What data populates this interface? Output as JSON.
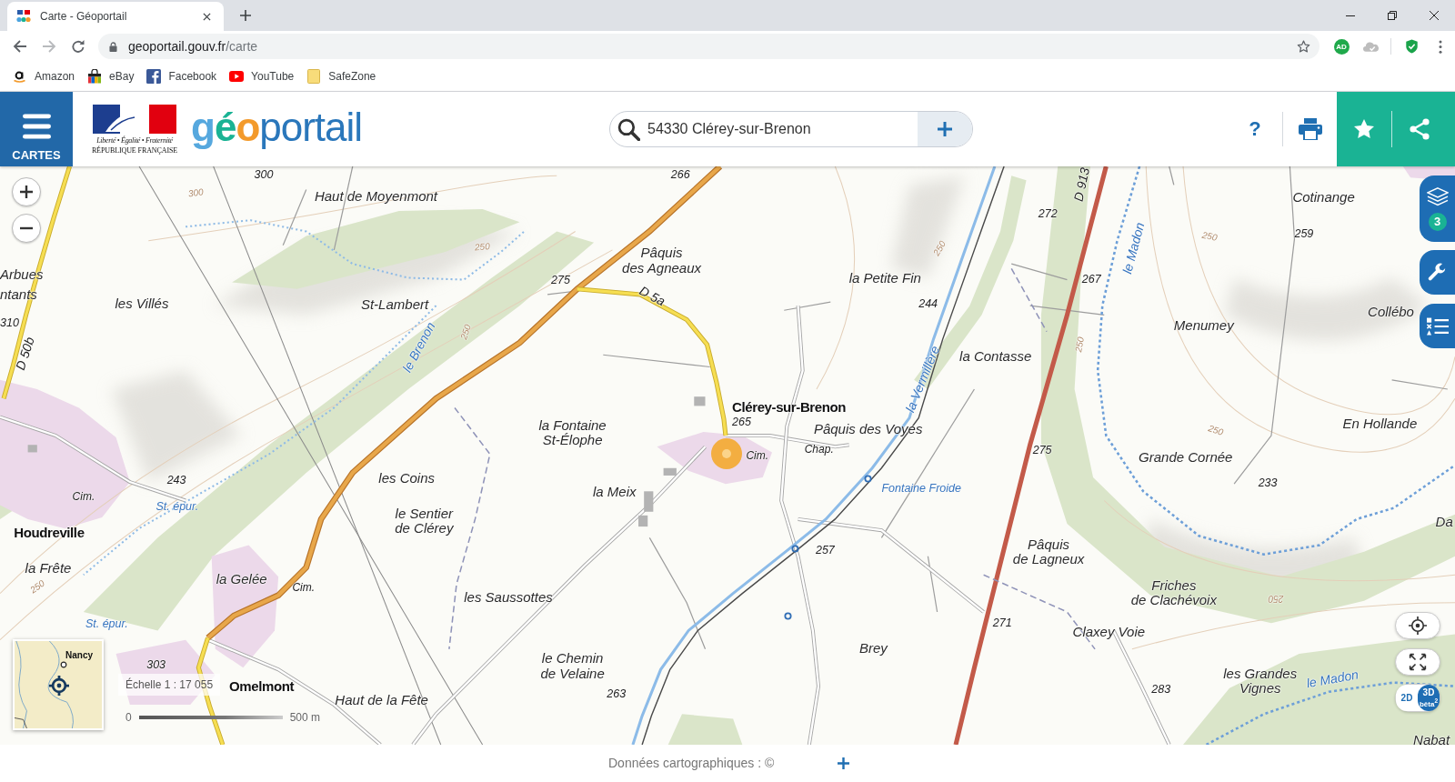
{
  "browser": {
    "tabs": [
      {
        "title": "Carte - Géoportail",
        "selected": true
      }
    ],
    "nav": [
      {
        "kind": "back",
        "disabled": false
      },
      {
        "kind": "forward",
        "disabled": true
      },
      {
        "kind": "reload",
        "disabled": false
      }
    ],
    "address": {
      "domain": "geoportail.gouv.fr",
      "path": "/carte"
    },
    "extensions": [
      {
        "kind": "badge",
        "label": "AD"
      },
      {
        "kind": "cloud"
      },
      {
        "kind": "shield"
      }
    ],
    "bookmarks": [
      {
        "label": "Amazon",
        "kind": "amazon"
      },
      {
        "label": "eBay",
        "kind": "bag"
      },
      {
        "label": "Facebook",
        "kind": "facebook"
      },
      {
        "label": "YouTube",
        "kind": "video"
      },
      {
        "label": "SafeZone",
        "kind": "folder"
      }
    ]
  },
  "header": {
    "menu_label": "CARTES",
    "republic_logo": {
      "motto": "Liberté • Égalité • Fraternité",
      "name": "RÉPUBLIQUE FRANÇAISE"
    },
    "site_logo": [
      {
        "text": "g",
        "kind": "light"
      },
      {
        "text": "é",
        "kind": "green"
      },
      {
        "text": "o",
        "kind": "accent"
      },
      {
        "text": "portail",
        "kind": "dark"
      }
    ],
    "search": {
      "value": "54330 Clérey-sur-Brenon"
    },
    "help": "?"
  },
  "map": {
    "labels": [
      {
        "text": "300",
        "kind": "elevation"
      },
      {
        "text": "266",
        "kind": "elevation"
      },
      {
        "text": "300",
        "kind": "contour"
      },
      {
        "text": "Haut de Moyenmont",
        "kind": "place"
      },
      {
        "text": "D 913",
        "kind": "road"
      },
      {
        "text": "Cotinange",
        "kind": "place"
      },
      {
        "text": "272",
        "kind": "elevation"
      },
      {
        "text": "250",
        "kind": "contour"
      },
      {
        "text": "259",
        "kind": "elevation"
      },
      {
        "text": "250",
        "kind": "contour"
      },
      {
        "text": "250",
        "kind": "contour"
      },
      {
        "text": "le Madon",
        "kind": "river"
      },
      {
        "text": "Arbues",
        "kind": "place"
      },
      {
        "lines": [
          "Pâquis",
          "des Agneaux"
        ],
        "kind": "place"
      },
      {
        "text": "275",
        "kind": "elevation"
      },
      {
        "text": "la Petite Fin",
        "kind": "place"
      },
      {
        "text": "267",
        "kind": "elevation"
      },
      {
        "text": "D 5a",
        "kind": "road"
      },
      {
        "text": "ntants",
        "kind": "place"
      },
      {
        "text": "les Villés",
        "kind": "place"
      },
      {
        "text": "St-Lambert",
        "kind": "place"
      },
      {
        "text": "244",
        "kind": "elevation"
      },
      {
        "text": "Collébo",
        "kind": "place"
      },
      {
        "text": "310",
        "kind": "elevation"
      },
      {
        "text": "Menumey",
        "kind": "place"
      },
      {
        "text": "250",
        "kind": "contour"
      },
      {
        "text": "250",
        "kind": "contour"
      },
      {
        "text": "le Brenon",
        "kind": "river"
      },
      {
        "text": "D 50b",
        "kind": "road"
      },
      {
        "text": "la Contasse",
        "kind": "place"
      },
      {
        "text": "la Vermillère",
        "kind": "river"
      },
      {
        "text": "Clérey-sur-Brenon",
        "kind": "town"
      },
      {
        "lines": [
          "la Fontaine",
          "St-Élophe"
        ],
        "kind": "place"
      },
      {
        "text": "265",
        "kind": "elevation"
      },
      {
        "text": "Pâquis des Voyes",
        "kind": "place"
      },
      {
        "text": "250",
        "kind": "contour"
      },
      {
        "text": "En Hollande",
        "kind": "place"
      },
      {
        "text": "Cim.",
        "kind": "small"
      },
      {
        "text": "Chap.",
        "kind": "small"
      },
      {
        "text": "275",
        "kind": "elevation"
      },
      {
        "text": "Grande Cornée",
        "kind": "place"
      },
      {
        "text": "243",
        "kind": "elevation"
      },
      {
        "text": "les Coins",
        "kind": "place"
      },
      {
        "text": "la Meix",
        "kind": "place"
      },
      {
        "text": "Fontaine Froide",
        "kind": "water"
      },
      {
        "text": "233",
        "kind": "elevation"
      },
      {
        "text": "Cim.",
        "kind": "small"
      },
      {
        "text": "St. épur.",
        "kind": "water"
      },
      {
        "lines": [
          "le Sentier",
          "de Clérey"
        ],
        "kind": "place"
      },
      {
        "text": "Da",
        "kind": "place"
      },
      {
        "text": "Houdreville",
        "kind": "town"
      },
      {
        "text": "257",
        "kind": "elevation"
      },
      {
        "lines": [
          "Pâquis",
          "de Lagneux"
        ],
        "kind": "place"
      },
      {
        "text": "la Frête",
        "kind": "place"
      },
      {
        "text": "250",
        "kind": "contour"
      },
      {
        "text": "la Gelée",
        "kind": "place"
      },
      {
        "text": "Cim.",
        "kind": "small"
      },
      {
        "text": "les Saussottes",
        "kind": "place"
      },
      {
        "lines": [
          "Friches",
          "de Clachévoix"
        ],
        "kind": "place"
      },
      {
        "text": "250",
        "kind": "contour"
      },
      {
        "text": "St. épur.",
        "kind": "water"
      },
      {
        "text": "271",
        "kind": "elevation"
      },
      {
        "text": "Claxey Voie",
        "kind": "place"
      },
      {
        "text": "Brey",
        "kind": "place"
      },
      {
        "text": "303",
        "kind": "elevation"
      },
      {
        "lines": [
          "le Chemin",
          "de Velaine"
        ],
        "kind": "place"
      },
      {
        "text": "Omelmont",
        "kind": "town"
      },
      {
        "text": "263",
        "kind": "elevation"
      },
      {
        "text": "283",
        "kind": "elevation"
      },
      {
        "lines": [
          "les Grandes",
          "Vignes"
        ],
        "kind": "place"
      },
      {
        "text": "le Madon",
        "kind": "river"
      },
      {
        "text": "Haut de la Fête",
        "kind": "place"
      },
      {
        "text": "Nabat",
        "kind": "place"
      }
    ],
    "layers_count": "3",
    "overview": {
      "label": "Nancy"
    },
    "scale": {
      "title": "Échelle 1 : 17 055",
      "start": "0",
      "end": "500 m"
    },
    "view_modes": [
      {
        "label": "2D",
        "selected": true
      },
      {
        "label": "3D",
        "note": "bêta$^{2}$",
        "selected": false
      }
    ]
  },
  "footer": {
    "credits": "Données cartographiques : ©"
  }
}
